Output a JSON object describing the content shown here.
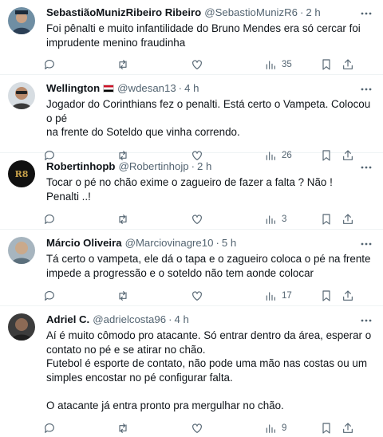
{
  "tweets": [
    {
      "name": "SebastiãoMunizRibeiro Ribeiro",
      "handle": "@SebastioMunizR6",
      "separator": "·",
      "time": "2 h",
      "text": "Foi pênalti e muito infantilidade do Bruno Mendes era só cercar foi\nimprudente menino fraudinha",
      "views": "35",
      "has_flag": false
    },
    {
      "name": "Wellington",
      "handle": "@wdesan13",
      "separator": "·",
      "time": "4 h",
      "text": "Jogador do Corinthians fez o penalti. Está certo o Vampeta. Colocou o pé\nna frente do Soteldo que vinha correndo.",
      "views": "26",
      "has_flag": true
    },
    {
      "name": "Robertinhopb",
      "handle": "@Robertinhojp",
      "separator": "·",
      "time": "2 h",
      "text": "Tocar o pé no chão exime o zagueiro de fazer a falta ? Não !\nPenalti ..!",
      "views": "3",
      "has_flag": false
    },
    {
      "name": "Márcio Oliveira",
      "handle": "@Marciovinagre10",
      "separator": "·",
      "time": "5 h",
      "text": "Tá certo o vampeta, ele dá o tapa e o zagueiro coloca o pé na frente\nimpede a progressão e o soteldo não tem aonde colocar",
      "views": "17",
      "has_flag": false
    },
    {
      "name": "Adriel C.",
      "handle": "@adrielcosta96",
      "separator": "·",
      "time": "4 h",
      "text": "Aí é muito cômodo pro atacante. Só entrar dentro da área, esperar o\ncontato no pé e se atirar no chão.\nFutebol é esporte de contato, não pode uma mão nas costas ou um\nsimples encostar no pé configurar falta.\n\nO atacante já entra pronto pra mergulhar no chão.",
      "views": "9",
      "has_flag": false
    }
  ],
  "icons": {
    "more": "more-icon",
    "reply": "reply-icon",
    "retweet": "retweet-icon",
    "like": "like-icon",
    "views": "views-icon",
    "bookmark": "bookmark-icon",
    "share": "share-icon"
  },
  "colors": {
    "text": "#0f1419",
    "secondary": "#536471",
    "divider": "#eff3f4"
  }
}
